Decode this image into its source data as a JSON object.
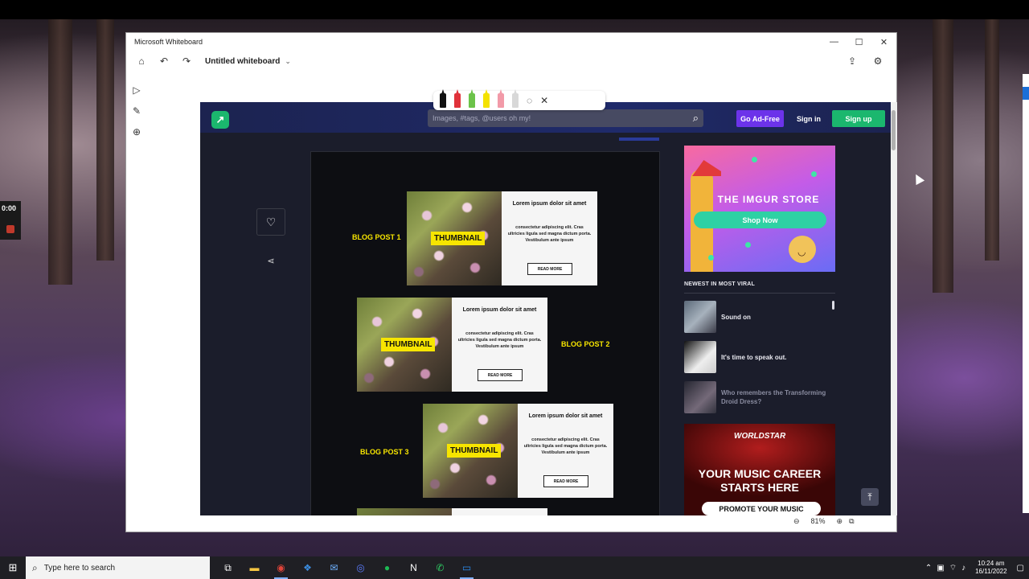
{
  "recorder": {
    "time": "0:00"
  },
  "window": {
    "title": "Microsoft Whiteboard",
    "controls": {
      "minimize": "—",
      "maximize": "☐",
      "close": "✕"
    }
  },
  "whiteboard": {
    "board_title": "Untitled whiteboard",
    "zoom_level": "81%"
  },
  "imgur": {
    "search_placeholder": "Images, #tags, @users oh my!",
    "go_ad_free": "Go Ad-Free",
    "sign_in": "Sign in",
    "sign_up": "Sign up",
    "posts": [
      {
        "label": "BLOG POST 1",
        "thumbnail": "THUMBNAIL",
        "heading": "Lorem ipsum dolor sit amet",
        "body": "consectetur adipiscing elit. Cras ultricies ligula sed magna dictum porta. Vestibulum ante ipsum",
        "read_more": "READ MORE"
      },
      {
        "label": "BLOG POST 2",
        "thumbnail": "THUMBNAIL",
        "heading": "Lorem ipsum dolor sit amet",
        "body": "consectetur adipiscing elit. Cras ultricies ligula sed magna dictum porta. Vestibulum ante ipsum",
        "read_more": "READ MORE"
      },
      {
        "label": "BLOG POST 3",
        "thumbnail": "THUMBNAIL",
        "heading": "Lorem ipsum dolor sit amet",
        "body": "consectetur adipiscing elit. Cras ultricies ligula sed magna dictum porta. Vestibulum ante ipsum",
        "read_more": "READ MORE"
      }
    ],
    "store_ad": {
      "title": "THE IMGUR STORE",
      "button": "Shop Now"
    },
    "newest_header": "NEWEST IN MOST VIRAL",
    "viral_items": [
      {
        "title": "Sound on"
      },
      {
        "title": "It's time to speak out."
      },
      {
        "title": "Who remembers the Transforming Droid Dress?"
      }
    ],
    "music_ad": {
      "brand": "WORLDSTAR",
      "headline": "YOUR MUSIC CAREER STARTS HERE",
      "cta": "PROMOTE YOUR MUSIC"
    }
  },
  "taskbar": {
    "search_placeholder": "Type here to search",
    "time": "10:24 am",
    "date": "16/11/2022"
  },
  "colors": {
    "imgur_green": "#1bb76e",
    "imgur_purple": "#6c33ea",
    "blog_label_yellow": "#f7e500"
  }
}
